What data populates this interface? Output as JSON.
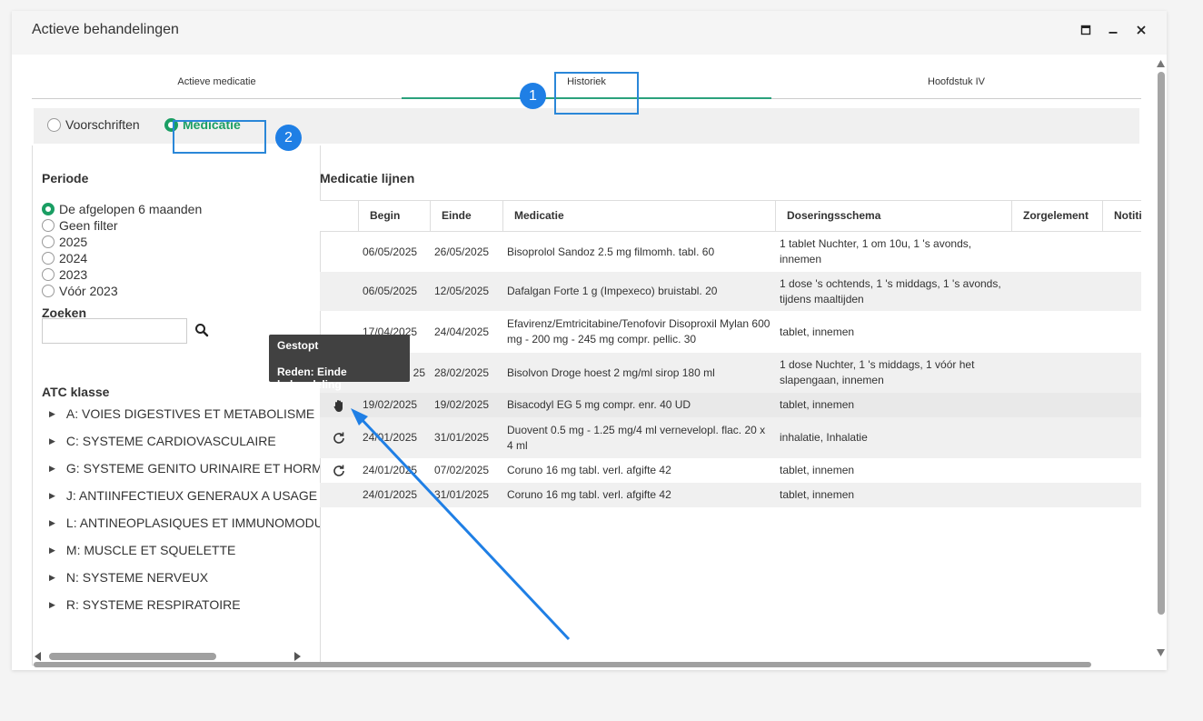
{
  "window": {
    "title": "Actieve behandelingen"
  },
  "tabs": [
    {
      "label": "Actieve medicatie"
    },
    {
      "label": "Historiek"
    },
    {
      "label": "Hoofdstuk IV"
    }
  ],
  "view_toggle": {
    "options": [
      "Voorschriften",
      "Medicatie"
    ],
    "selected": "Medicatie"
  },
  "annotations": {
    "badge1": "1",
    "badge2": "2"
  },
  "left": {
    "period_label": "Periode",
    "period_options": [
      "De afgelopen 6 maanden",
      "Geen filter",
      "2025",
      "2024",
      "2023",
      "Vóór 2023"
    ],
    "search_label": "Zoeken",
    "search_value": "",
    "atc_label": "ATC klasse",
    "atc_items": [
      "A: VOIES DIGESTIVES ET METABOLISME",
      "C: SYSTEME CARDIOVASCULAIRE",
      "G: SYSTEME GENITO URINAIRE ET HORMONES SEXUELLES",
      "J: ANTIINFECTIEUX GENERAUX A USAGE SYSTEMIQUE",
      "L: ANTINEOPLASIQUES ET IMMUNOMODULATEURS",
      "M: MUSCLE ET SQUELETTE",
      "N: SYSTEME NERVEUX",
      "R: SYSTEME RESPIRATOIRE"
    ]
  },
  "medication": {
    "title": "Medicatie lijnen",
    "columns": [
      "Begin",
      "Einde",
      "Medicatie",
      "Doseringsschema",
      "Zorgelement",
      "Notitie"
    ],
    "rows": [
      {
        "icon": "",
        "begin": "06/05/2025",
        "einde": "26/05/2025",
        "medicatie": "Bisoprolol Sandoz 2.5 mg filmomh. tabl. 60",
        "dosering": "1 tablet Nuchter, 1 om 10u, 1 's avonds, innemen"
      },
      {
        "icon": "",
        "begin": "06/05/2025",
        "einde": "12/05/2025",
        "medicatie": "Dafalgan Forte 1 g (Impexeco) bruistabl. 20",
        "dosering": "1 dose 's ochtends, 1 's middags, 1 's avonds, tijdens maaltijden"
      },
      {
        "icon": "",
        "begin": "17/04/2025",
        "einde": "24/04/2025",
        "medicatie": "Efavirenz/Emtricitabine/Tenofovir Disoproxil Mylan 600 mg - 200 mg - 245 mg compr. pellic. 30",
        "dosering": "tablet, innemen"
      },
      {
        "icon": "",
        "begin": "25",
        "einde": "28/02/2025",
        "medicatie": "Bisolvon Droge hoest 2 mg/ml sirop 180 ml",
        "dosering": "1 dose Nuchter, 1 's middags, 1 vóór het slapengaan, innemen"
      },
      {
        "icon": "stopped-hand-icon",
        "begin": "19/02/2025",
        "einde": "19/02/2025",
        "medicatie": "Bisacodyl EG 5 mg compr. enr. 40 UD",
        "dosering": "tablet, innemen"
      },
      {
        "icon": "renew-icon",
        "begin": "24/01/2025",
        "einde": "31/01/2025",
        "medicatie": "Duovent 0.5 mg - 1.25 mg/4 ml vernevelopl. flac. 20 x 4 ml",
        "dosering": "inhalatie, Inhalatie"
      },
      {
        "icon": "renew-icon",
        "begin": "24/01/2025",
        "einde": "07/02/2025",
        "medicatie": "Coruno 16 mg tabl. verl. afgifte 42",
        "dosering": "tablet, innemen"
      },
      {
        "icon": "",
        "begin": "24/01/2025",
        "einde": "31/01/2025",
        "medicatie": "Coruno 16 mg tabl. verl. afgifte 42",
        "dosering": "tablet, innemen"
      }
    ]
  },
  "tooltip": {
    "line1": "Gestopt",
    "line2": "Reden: Einde behandeling"
  },
  "colors": {
    "accent": "#1a9e63",
    "tab_underline": "#2aa17c",
    "annotation": "#1f7fe5"
  }
}
